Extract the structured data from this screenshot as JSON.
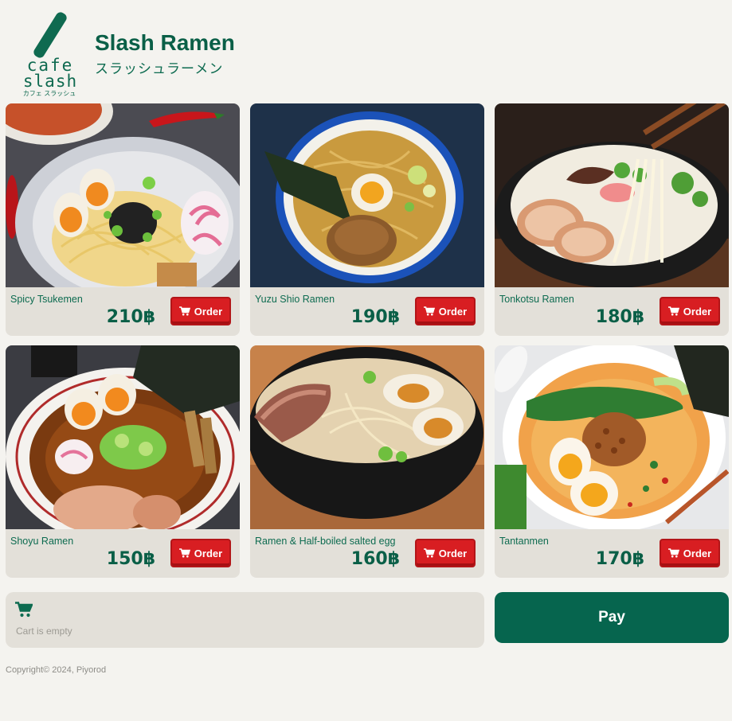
{
  "header": {
    "logo": {
      "line1": "cafe",
      "line2": "slash",
      "line3": "カフェ スラッシュ"
    },
    "title": "Slash Ramen",
    "subtitle": "スラッシュラーメン"
  },
  "menu": {
    "order_label": "Order",
    "items": [
      {
        "name": "Spicy Tsukemen",
        "price": "210฿"
      },
      {
        "name": "Yuzu Shio Ramen",
        "price": "190฿"
      },
      {
        "name": "Tonkotsu Ramen",
        "price": "180฿"
      },
      {
        "name": "Shoyu Ramen",
        "price": "150฿"
      },
      {
        "name": "Ramen & Half-boiled salted egg",
        "price": "160฿"
      },
      {
        "name": "Tantanmen",
        "price": "170฿"
      }
    ]
  },
  "cart": {
    "icon": "cart-icon",
    "empty_text": "Cart is empty"
  },
  "pay": {
    "label": "Pay"
  },
  "footer": {
    "copyright": "Copyright© 2024, Piyorod"
  },
  "colors": {
    "brand_green": "#06654e",
    "order_red": "#d81e22",
    "panel": "#e3e0d9",
    "background": "#f4f3ef"
  }
}
